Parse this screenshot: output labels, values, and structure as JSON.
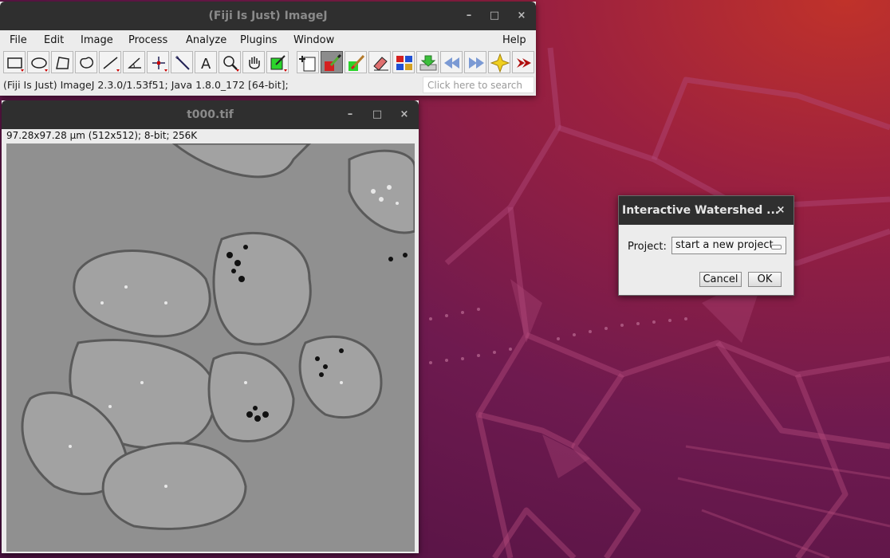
{
  "imagej": {
    "title": "(Fiji Is Just) ImageJ",
    "menus": [
      "File",
      "Edit",
      "Image",
      "Process",
      "Analyze",
      "Plugins",
      "Window",
      "Help"
    ],
    "tools": [
      "rectangle-tool",
      "oval-tool",
      "polygon-tool",
      "freehand-tool",
      "line-tool",
      "angle-tool",
      "point-tool",
      "wand-tool",
      "text-tool",
      "magnifier-tool",
      "hand-tool",
      "color-picker-tool",
      "new-image-tool",
      "paintbrush-tool",
      "pencil-tool",
      "eraser-tool",
      "lut-tool",
      "download-tool",
      "back-tool",
      "forward-tool",
      "star-tool",
      "more-tools"
    ],
    "status": "(Fiji Is Just) ImageJ 2.3.0/1.53f51; Java 1.8.0_172 [64-bit];",
    "search_placeholder": "Click here to search"
  },
  "image_window": {
    "title": "t000.tif",
    "info": "97.28x97.28 µm (512x512); 8-bit; 256K"
  },
  "dialog": {
    "title": "Interactive Watershed ...",
    "project_label": "Project:",
    "project_value": "start a new project",
    "cancel_label": "Cancel",
    "ok_label": "OK"
  },
  "window_controls": {
    "minimize": "–",
    "maximize": "□",
    "close": "×"
  },
  "colors": {
    "titlebar": "#2f2f2f",
    "window_bg": "#ececec",
    "accent_red": "#d42020",
    "wallpaper": "#6e1a4f"
  }
}
